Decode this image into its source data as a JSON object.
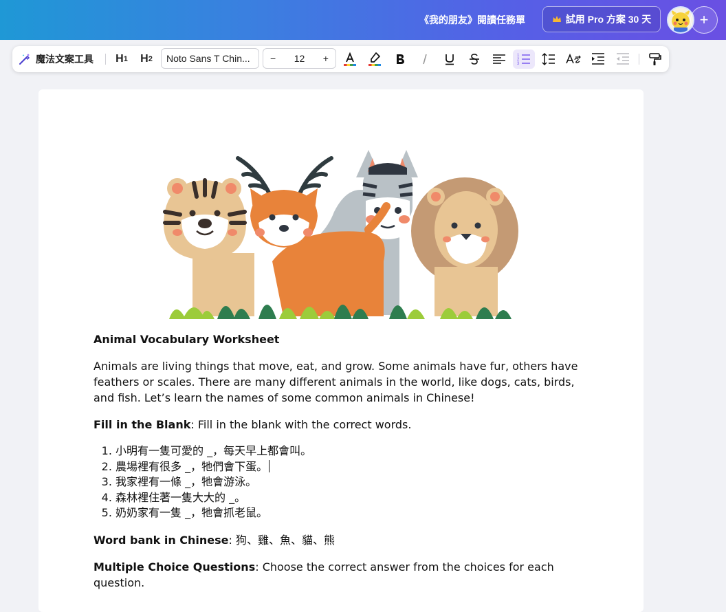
{
  "header": {
    "doc_title": "《我的朋友》閱讀任務單",
    "pro_button_label": "試用 Pro 方案 30 天",
    "add_label": "+"
  },
  "toolbar": {
    "magic_label": "魔法文案工具",
    "h1_label": "H",
    "h1_sub": "1",
    "h2_label": "H",
    "h2_sub": "2",
    "font_name": "Noto Sans T Chin...",
    "size_minus": "−",
    "font_size": "12",
    "size_plus": "+"
  },
  "colors": {
    "accent": "#7b5cf0",
    "header_gradient_start": "#1f98d6",
    "header_gradient_end": "#6a4fe3",
    "active_tool_bg": "#ece7fb"
  },
  "document": {
    "worksheet_title": "Animal Vocabulary Worksheet",
    "intro": "Animals are living things that move, eat, and grow. Some animals have fur, others have feathers or scales. There are many different animals in the world, like dogs, cats, birds, and fish. Let’s learn the names of some common animals in Chinese!",
    "fill_heading": "Fill in the Blank",
    "fill_instruction": ": Fill in the blank with the correct words.",
    "fill_items": [
      "小明有一隻可愛的 _，每天早上都會叫。",
      "農場裡有很多 _，牠們會下蛋。",
      "我家裡有一條 _，牠會游泳。",
      "森林裡住著一隻大大的 _。",
      "奶奶家有一隻 _，牠會抓老鼠。"
    ],
    "word_bank_heading": "Word bank in Chinese",
    "word_bank_words": ": 狗、雞、魚、貓、熊",
    "mc_heading": "Multiple Choice Questions",
    "mc_instruction": ": Choose the correct answer from the choices for each question."
  }
}
